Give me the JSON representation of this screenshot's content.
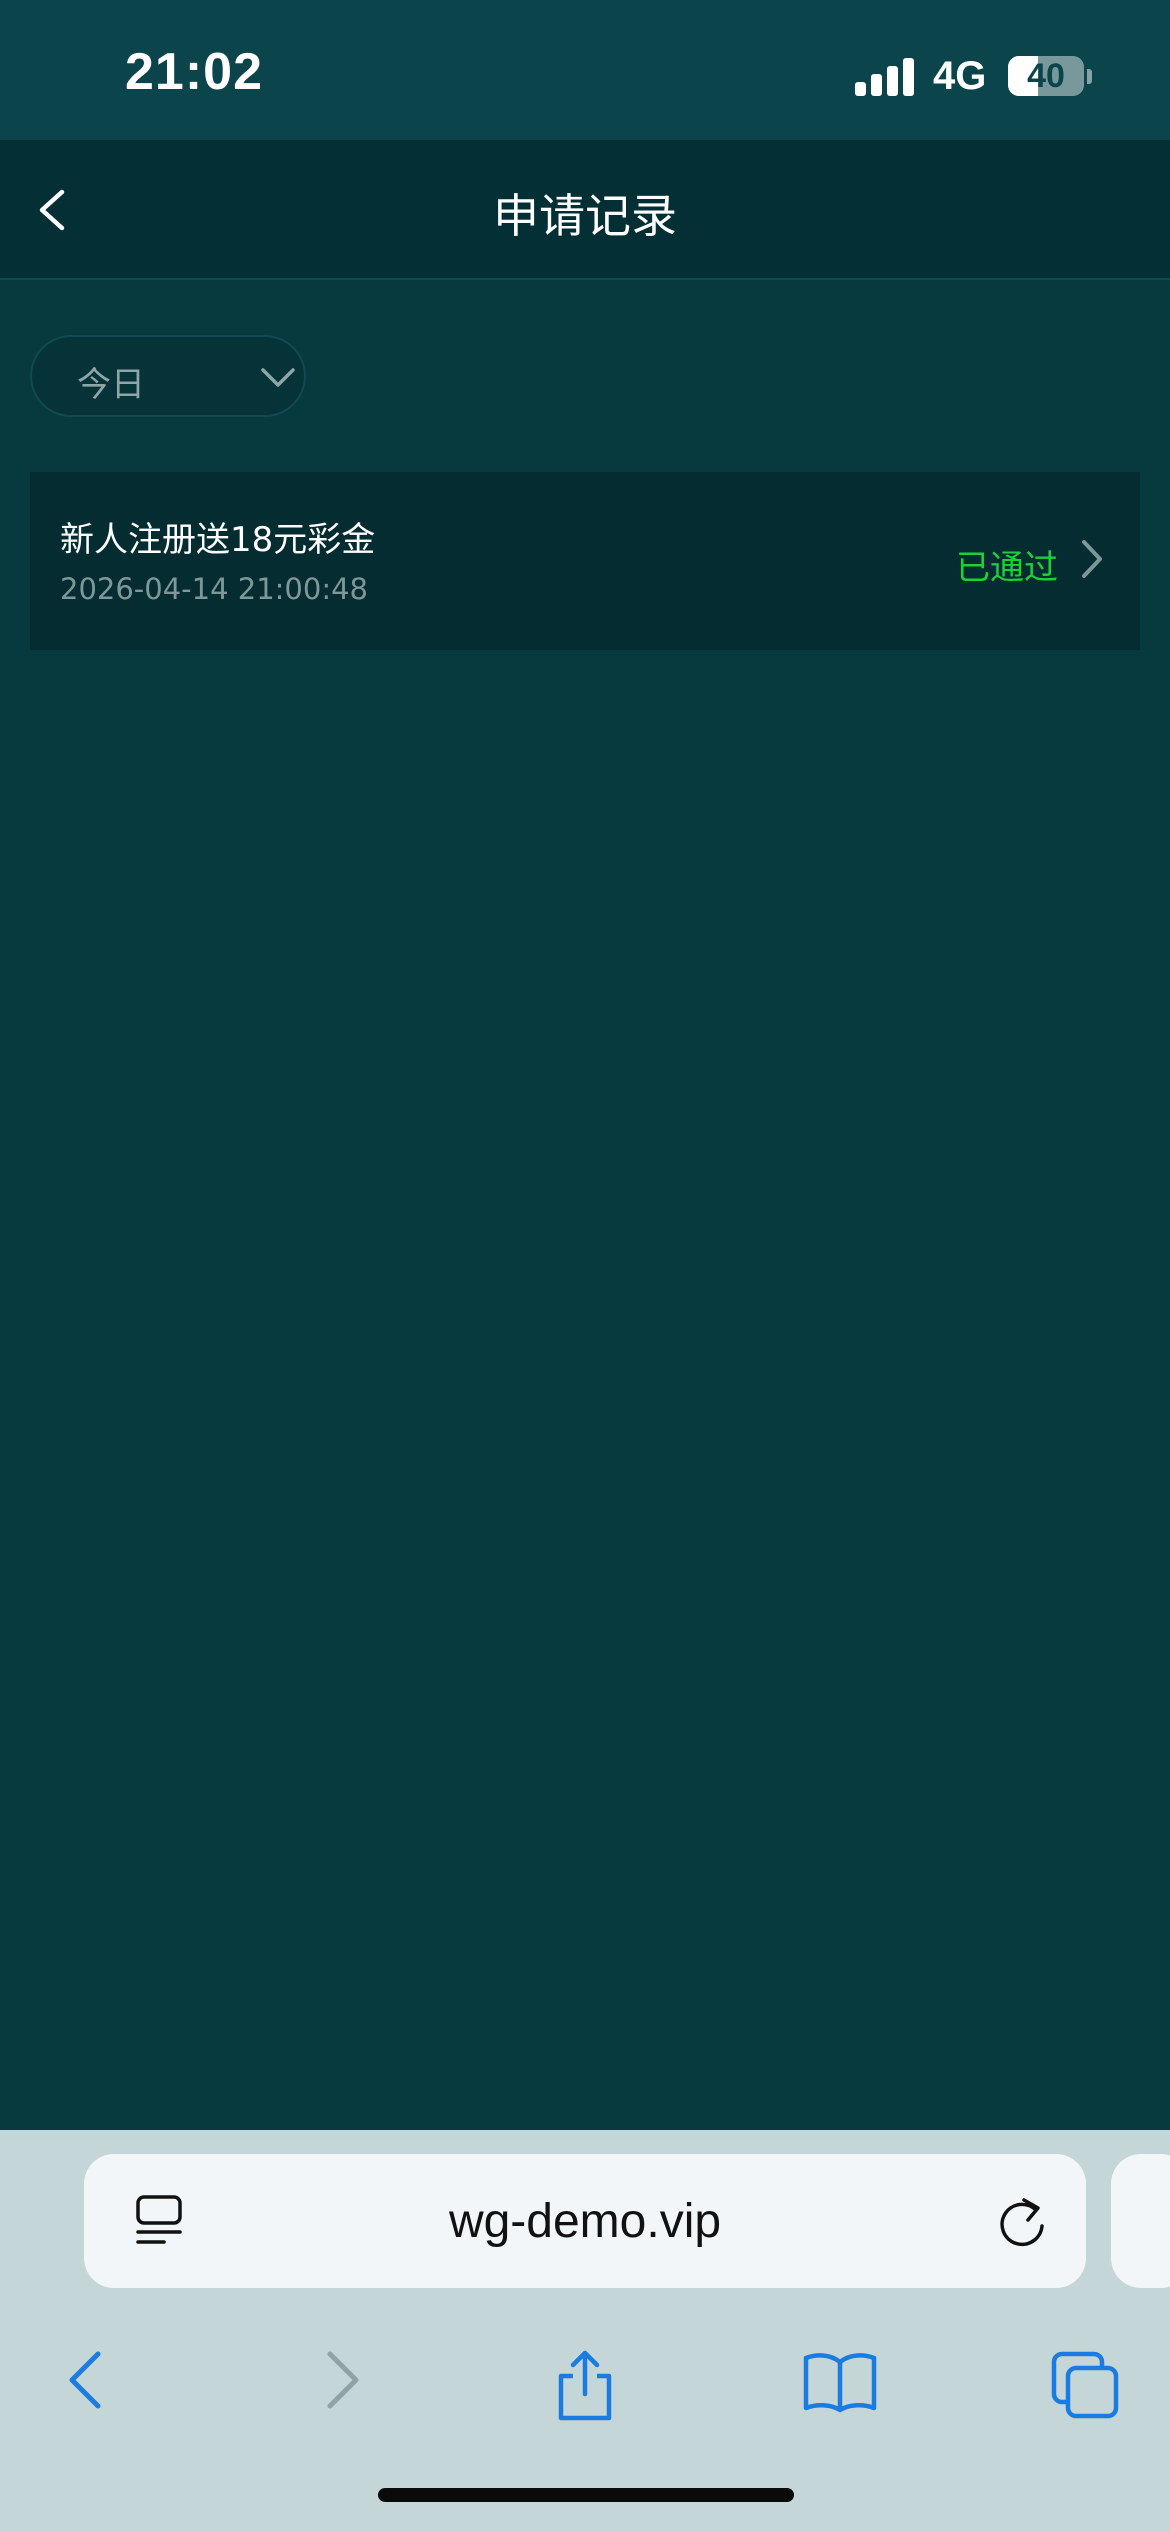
{
  "status_bar": {
    "time": "21:02",
    "network": "4G",
    "battery_level": "40",
    "battery_fraction": 0.4,
    "signal_bars": 4
  },
  "nav": {
    "title": "申请记录",
    "back_icon": "chevron-left-icon"
  },
  "filter": {
    "selected": "今日",
    "icon": "chevron-down-icon"
  },
  "records": [
    {
      "title": "新人注册送18元彩金",
      "time": "2026-04-14 21:00:48",
      "status": "已通过",
      "status_color": "#1fcf3a"
    }
  ],
  "browser": {
    "url": "wg-demo.vip",
    "icons": [
      "page-menu-icon",
      "reload-icon",
      "back-icon",
      "forward-icon",
      "share-icon",
      "bookmarks-icon",
      "tabs-icon"
    ]
  },
  "colors": {
    "background": "#073a3f",
    "header": "#042f34",
    "accent_link": "#1a7be0"
  }
}
